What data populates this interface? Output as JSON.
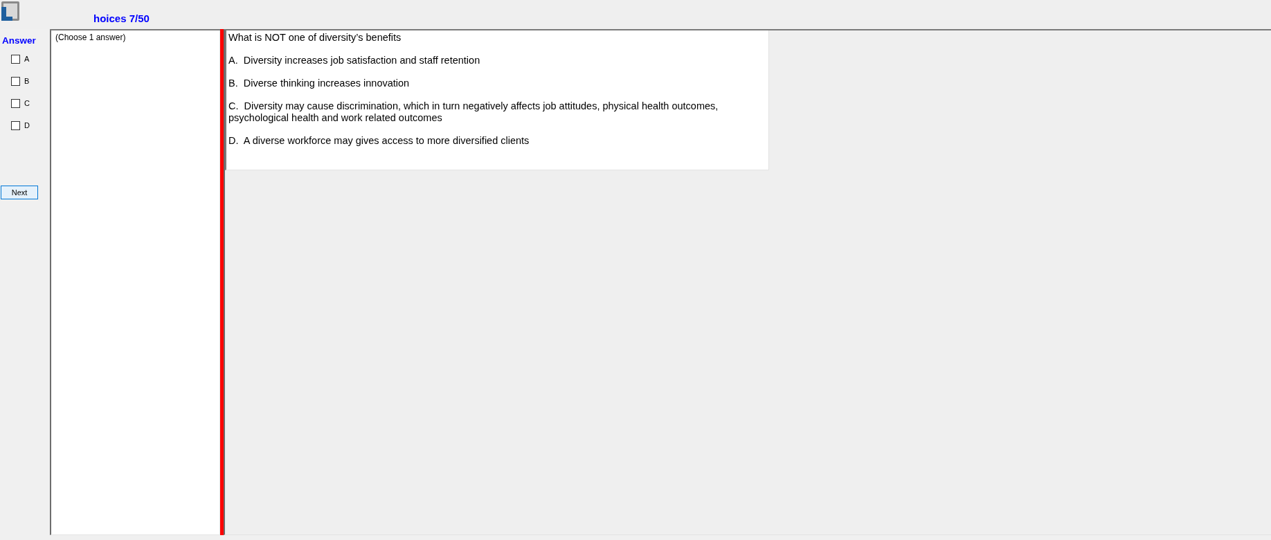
{
  "header": {
    "title": "hoices 7/50"
  },
  "answer_panel": {
    "heading": "Answer",
    "choices": [
      {
        "label": "A",
        "checked": false
      },
      {
        "label": "B",
        "checked": false
      },
      {
        "label": "C",
        "checked": false
      },
      {
        "label": "D",
        "checked": false
      }
    ],
    "next_button": "Next"
  },
  "instructions": "(Choose 1 answer)",
  "question": {
    "stem": "What is NOT one of diversity’s benefits",
    "options": [
      "A.  Diversity increases job satisfaction and staff retention",
      "B.  Diverse thinking increases innovation",
      "C.  Diversity may cause discrimination, which in turn negatively affects job attitudes, physical health outcomes, psychological health and work related outcomes",
      "D.  A diverse workforce may gives access to more diversified clients"
    ]
  }
}
